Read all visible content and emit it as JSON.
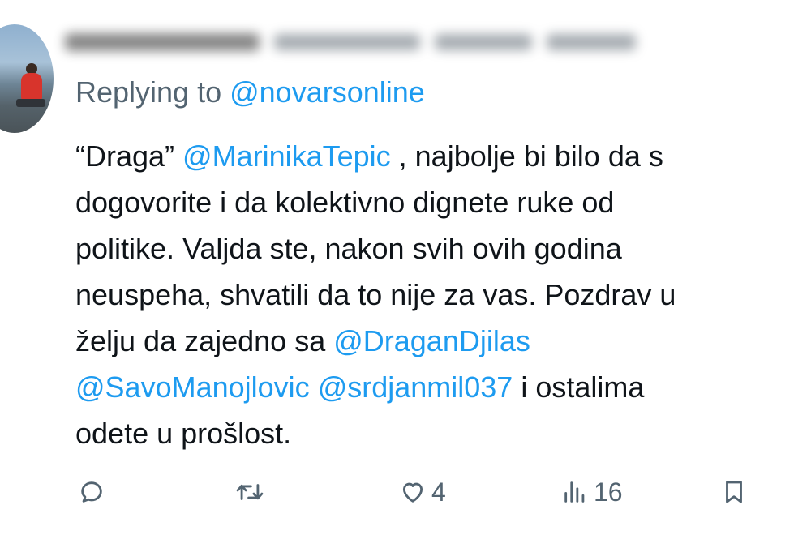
{
  "tweet": {
    "replying_prefix": "Replying to ",
    "replying_handle": "@novarsonline",
    "lines": [
      [
        {
          "text": "“Draga” ",
          "mention": false
        },
        {
          "text": "@MarinikaTepic",
          "mention": true
        },
        {
          "text": " , najbolje bi bilo da s",
          "mention": false
        }
      ],
      [
        {
          "text": "dogovorite i da kolektivno dignete ruke od",
          "mention": false
        }
      ],
      [
        {
          "text": "politike. Valjda ste, nakon svih ovih godina",
          "mention": false
        }
      ],
      [
        {
          "text": "neuspeha, shvatili da to nije za vas. Pozdrav u",
          "mention": false
        }
      ],
      [
        {
          "text": "želju da zajedno sa ",
          "mention": false
        },
        {
          "text": "@DraganDjilas",
          "mention": true
        }
      ],
      [
        {
          "text": "@SavoManojlovic",
          "mention": true
        },
        {
          "text": " ",
          "mention": false
        },
        {
          "text": "@srdjanmil037",
          "mention": true
        },
        {
          "text": " i ostalima",
          "mention": false
        }
      ],
      [
        {
          "text": "odete u prošlost.",
          "mention": false
        }
      ]
    ]
  },
  "actions": {
    "reply_icon": "reply-icon",
    "retweet_icon": "retweet-icon",
    "like_icon": "like-icon",
    "like_count": "4",
    "views_icon": "views-icon",
    "views_count": "16",
    "bookmark_icon": "bookmark-icon"
  },
  "colors": {
    "mention": "#1d9bf0",
    "secondary_text": "#536471",
    "primary_text": "#0f1419"
  }
}
